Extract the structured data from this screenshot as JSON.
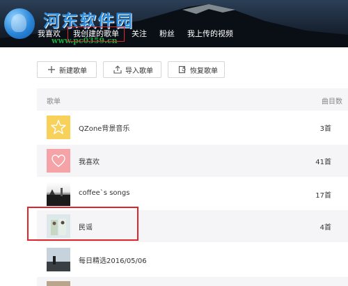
{
  "watermark": {
    "title": "河东软件园",
    "url": "www.pc0359.cn"
  },
  "tabs": [
    {
      "label": "我喜欢",
      "active": false
    },
    {
      "label": "我创建的歌单",
      "active": true
    },
    {
      "label": "关注",
      "active": false
    },
    {
      "label": "粉丝",
      "active": false
    },
    {
      "label": "我上传的视频",
      "active": false
    }
  ],
  "toolbar": {
    "new_label": "新建歌单",
    "import_label": "导入歌单",
    "restore_label": "恢复歌单"
  },
  "table": {
    "col_playlist": "歌单",
    "col_count": "曲目数",
    "rows": [
      {
        "name": "QZone背景音乐",
        "count": "3首",
        "cover_icon": "star-icon"
      },
      {
        "name": "我喜欢",
        "count": "41首",
        "cover_icon": "heart-icon"
      },
      {
        "name": "coffee`s songs",
        "count": "17首",
        "cover_icon": "photo"
      },
      {
        "name": "民谣",
        "count": "4首",
        "cover_icon": "photo"
      },
      {
        "name": "每日精选2016/05/06",
        "count": "",
        "cover_icon": "photo"
      }
    ]
  },
  "colors": {
    "accent_red": "#e0232a",
    "star_cover": "#f7d159",
    "heart_cover": "#f5a3a7",
    "row_alt_bg": "#f5f5f7"
  }
}
